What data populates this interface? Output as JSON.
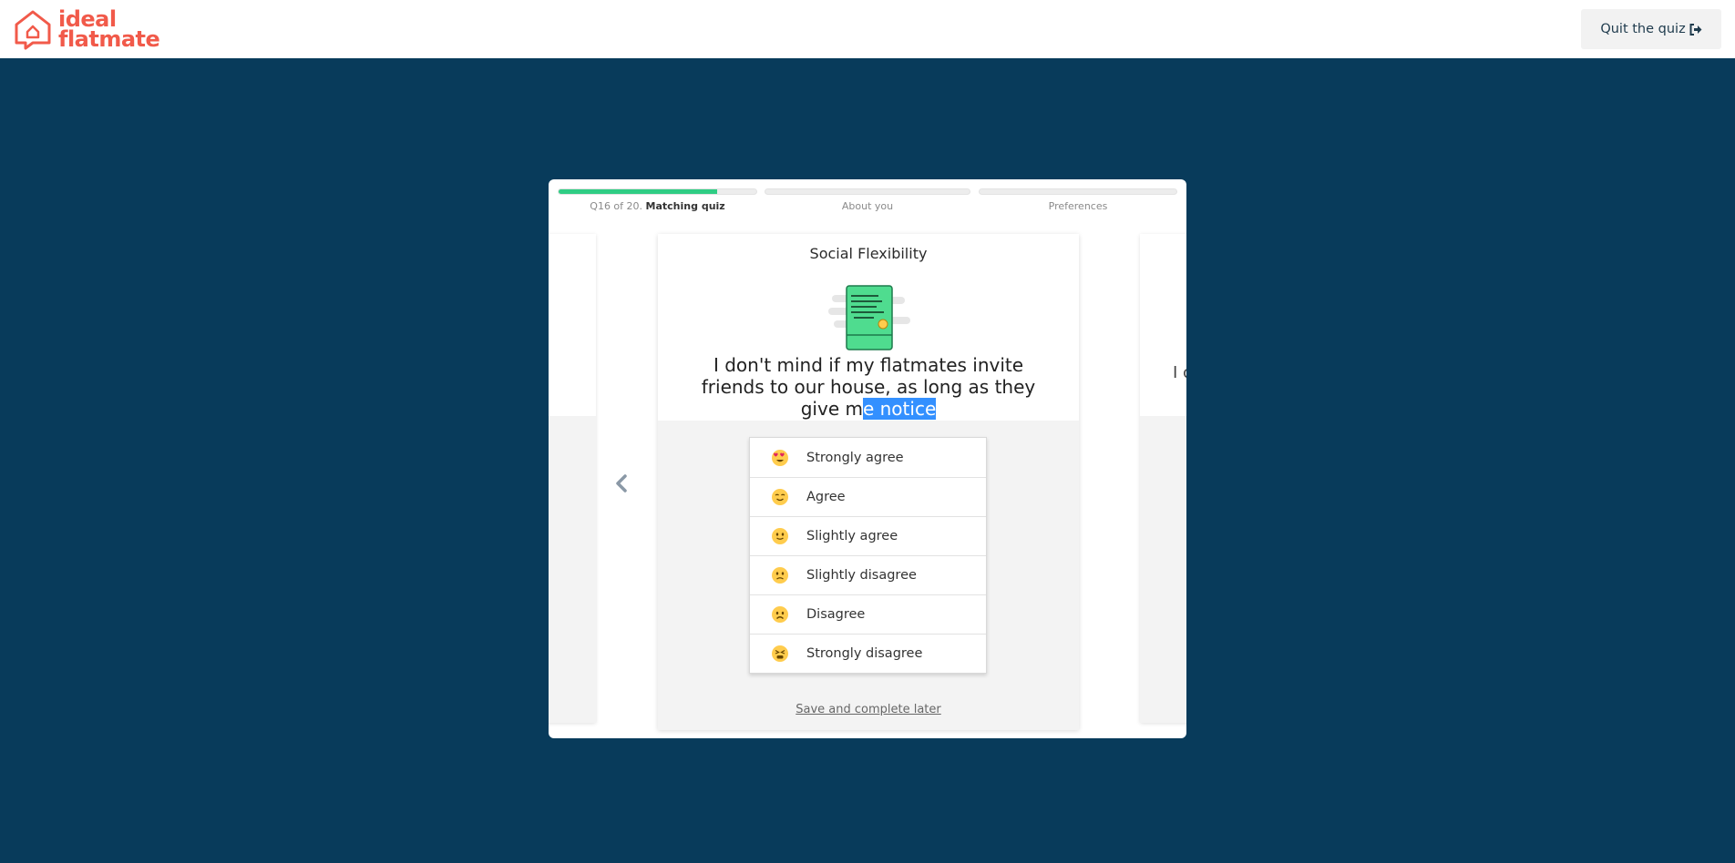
{
  "brand": {
    "line1": "ideal",
    "line2": "flatmate",
    "color": "#f15a4a"
  },
  "header": {
    "quit_label": "Quit the quiz"
  },
  "progress": {
    "steps": [
      {
        "prefix": "Q16 of 20.",
        "name": "Matching quiz",
        "fill": 0.8
      },
      {
        "name": "About you",
        "fill": 0
      },
      {
        "name": "Preferences",
        "fill": 0
      }
    ],
    "accent": "#2fcd84"
  },
  "card": {
    "title": "Social Flexibility",
    "question_part1": "I don't mind if my flatmates invite friends to our house, as long as they give m",
    "question_selected": "e notice",
    "options": [
      {
        "label": "Strongly agree",
        "icon": "heart-eyes-emoji-icon"
      },
      {
        "label": "Agree",
        "icon": "relieved-emoji-icon"
      },
      {
        "label": "Slightly agree",
        "icon": "slight-smile-emoji-icon"
      },
      {
        "label": "Slightly disagree",
        "icon": "slight-frown-emoji-icon"
      },
      {
        "label": "Disagree",
        "icon": "frown-emoji-icon"
      },
      {
        "label": "Strongly disagree",
        "icon": "distressed-emoji-icon"
      }
    ],
    "save_label": "Save and complete later"
  },
  "next_card_peek": "I c"
}
